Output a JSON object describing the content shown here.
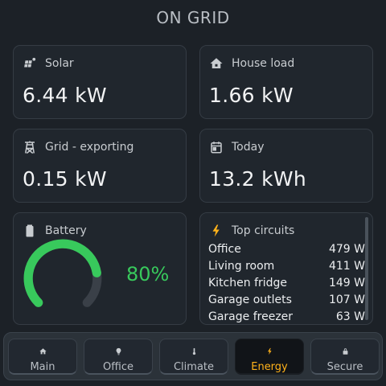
{
  "header": {
    "title": "ON GRID"
  },
  "cards": {
    "solar": {
      "label": "Solar",
      "value": "6.44 kW"
    },
    "house": {
      "label": "House load",
      "value": "1.66 kW"
    },
    "grid": {
      "label": "Grid - exporting",
      "value": "0.15 kW"
    },
    "today": {
      "label": "Today",
      "value": "13.2 kWh"
    }
  },
  "battery": {
    "label": "Battery",
    "percent_text": "80%",
    "level": 0.8,
    "color": "#38c95c"
  },
  "circuits": {
    "label": "Top circuits",
    "items": [
      {
        "name": "Office",
        "value": "479 W"
      },
      {
        "name": "Living room",
        "value": "411 W"
      },
      {
        "name": "Kitchen fridge",
        "value": "149 W"
      },
      {
        "name": "Garage outlets",
        "value": "107 W"
      },
      {
        "name": "Garage freezer",
        "value": "63 W"
      }
    ]
  },
  "nav": {
    "items": [
      {
        "label": "Main",
        "icon": "home-icon"
      },
      {
        "label": "Office",
        "icon": "lightbulb-icon"
      },
      {
        "label": "Climate",
        "icon": "thermometer-icon"
      },
      {
        "label": "Energy",
        "icon": "lightning-icon",
        "active": true
      },
      {
        "label": "Secure",
        "icon": "lock-icon"
      }
    ],
    "active_color": "#ffb21a"
  }
}
